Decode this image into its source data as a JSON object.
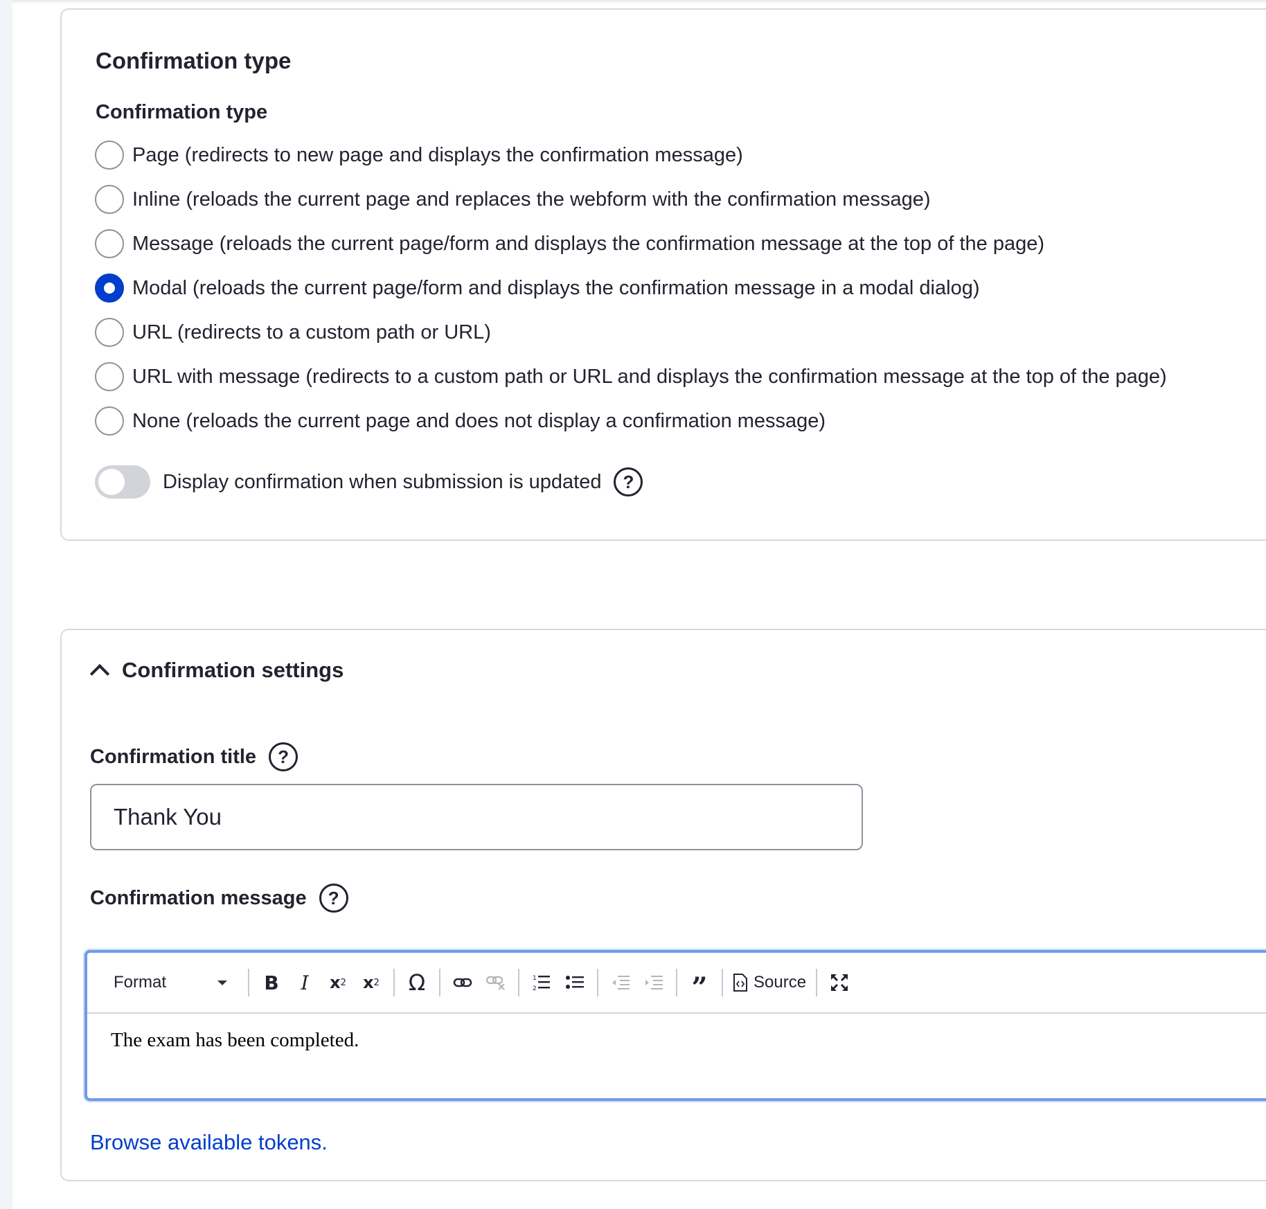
{
  "confirmation_type_section": {
    "legend": "Confirmation type",
    "radio_group_label": "Confirmation type",
    "options": [
      {
        "label": "Page (redirects to new page and displays the confirmation message)",
        "checked": false
      },
      {
        "label": "Inline (reloads the current page and replaces the webform with the confirmation message)",
        "checked": false
      },
      {
        "label": "Message (reloads the current page/form and displays the confirmation message at the top of the page)",
        "checked": false
      },
      {
        "label": "Modal (reloads the current page/form and displays the confirmation message in a modal dialog)",
        "checked": true
      },
      {
        "label": "URL (redirects to a custom path or URL)",
        "checked": false
      },
      {
        "label": "URL with message (redirects to a custom path or URL and displays the confirmation message at the top of the page)",
        "checked": false
      },
      {
        "label": "None (reloads the current page and does not display a confirmation message)",
        "checked": false
      }
    ],
    "toggle": {
      "label": "Display confirmation when submission is updated",
      "on": false
    },
    "help_glyph": "?"
  },
  "confirmation_settings_section": {
    "summary": "Confirmation settings",
    "expanded": true,
    "title_field": {
      "label": "Confirmation title",
      "value": "Thank You"
    },
    "message_field": {
      "label": "Confirmation message"
    },
    "editor": {
      "format_label": "Format",
      "source_label": "Source",
      "content": "The exam has been completed."
    },
    "tokens_link": "Browse available tokens."
  },
  "colors": {
    "accent": "#003ecc",
    "editor_focus_border": "#6f9ae9",
    "border": "#d8d9e0",
    "text": "#222330"
  }
}
